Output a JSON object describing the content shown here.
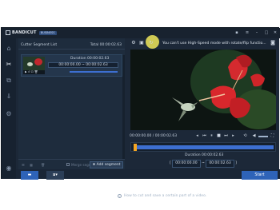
{
  "app": {
    "name": "BANDICUT",
    "edition": "BUSINESS",
    "window_controls": [
      "minimize",
      "maximize",
      "close"
    ]
  },
  "left_rail": {
    "items": [
      "home-icon",
      "cut-icon",
      "folder-icon",
      "gear-icon",
      "help-icon"
    ]
  },
  "segment_list": {
    "title": "Cutter Segment List",
    "total": "Total 00:00:02.63",
    "segments": [
      {
        "duration_label": "Duration 00:00:02.63",
        "range": "00:00:00.00  ~  00:00:02.63"
      }
    ],
    "merge_label": "Merge segments",
    "add_segment_label": "Add segment"
  },
  "player": {
    "message": "You can't use High-Speed mode with rotate/flip functio...",
    "time": "00:00:00.00 / 00:00:02.63",
    "duration_label": "Duration 00:00:02.63",
    "range_start": "00:00:00.00",
    "range_end": "00:00:02.63",
    "range_sep": "~",
    "selection_fraction": 1.0
  },
  "bottom": {
    "start_label": "Start",
    "tip": "How to cut and save a certain part of a video."
  },
  "colors": {
    "accent": "#3d6fd1",
    "start_marker": "#f5a623",
    "highlight": "#f0e65a",
    "background": "#1c2838"
  }
}
